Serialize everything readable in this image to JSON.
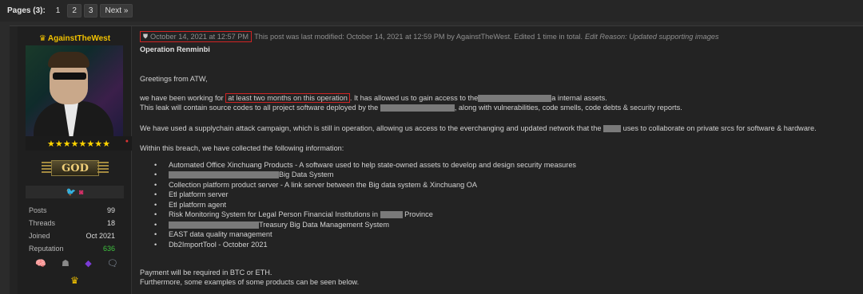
{
  "pagination": {
    "label": "Pages (3):",
    "pages": [
      "1",
      "2",
      "3"
    ],
    "next": "Next »"
  },
  "user": {
    "name": "AgainstTheWest",
    "stars": "★★★★★★★★",
    "rank": "GOD",
    "stats": [
      {
        "key": "Posts",
        "value": "99"
      },
      {
        "key": "Threads",
        "value": "18"
      },
      {
        "key": "Joined",
        "value": "Oct 2021"
      },
      {
        "key": "Reputation",
        "value": "636"
      }
    ]
  },
  "post": {
    "date": "October 14, 2021 at 12:57 PM",
    "modified": "This post was last modified: October 14, 2021 at 12:59 PM by AgainstTheWest. Edited 1 time in total.",
    "edit_reason": "Edit Reason: Updated supporting images",
    "title": "Operation Renminbi",
    "greeting": "Greetings from ATW,",
    "p1_a": "we have been working for ",
    "p1_hl": "at least two months on this operation",
    "p1_b": ". It has allowed us to gain access to the",
    "p1_c": "a internal assets.",
    "p2_a": "This leak will contain source codes to all project software deployed by the",
    "p2_b": ", along with vulnerabilities, code smells, code debts & security reports.",
    "p3_a": "We have used a supplychain attack campaign, which is still in operation, allowing us access to the everchanging and updated network that the",
    "p3_b": "uses to collaborate on private srcs for software & hardware.",
    "p4": "Within this breach, we have collected the following information:",
    "items": {
      "i1": "Automated Office Xinchuang Products - A software used to help state-owned assets to develop and design security measures",
      "i2": "Big Data System",
      "i3": "Collection platform product server - A link server between the Big data system & Xinchuang OA",
      "i4": "Etl platform server",
      "i5": "Etl platform agent",
      "i6a": "Risk Monitoring System for Legal Person Financial Institutions in",
      "i6b": "Province",
      "i7": "Treasury Big Data Management System",
      "i8": "EAST data quality management",
      "i9": "Db2ImportTool - October 2021"
    },
    "payment": "Payment will be required in BTC or ETH.",
    "furthermore": "Furthermore, some examples of some products can be seen below."
  }
}
